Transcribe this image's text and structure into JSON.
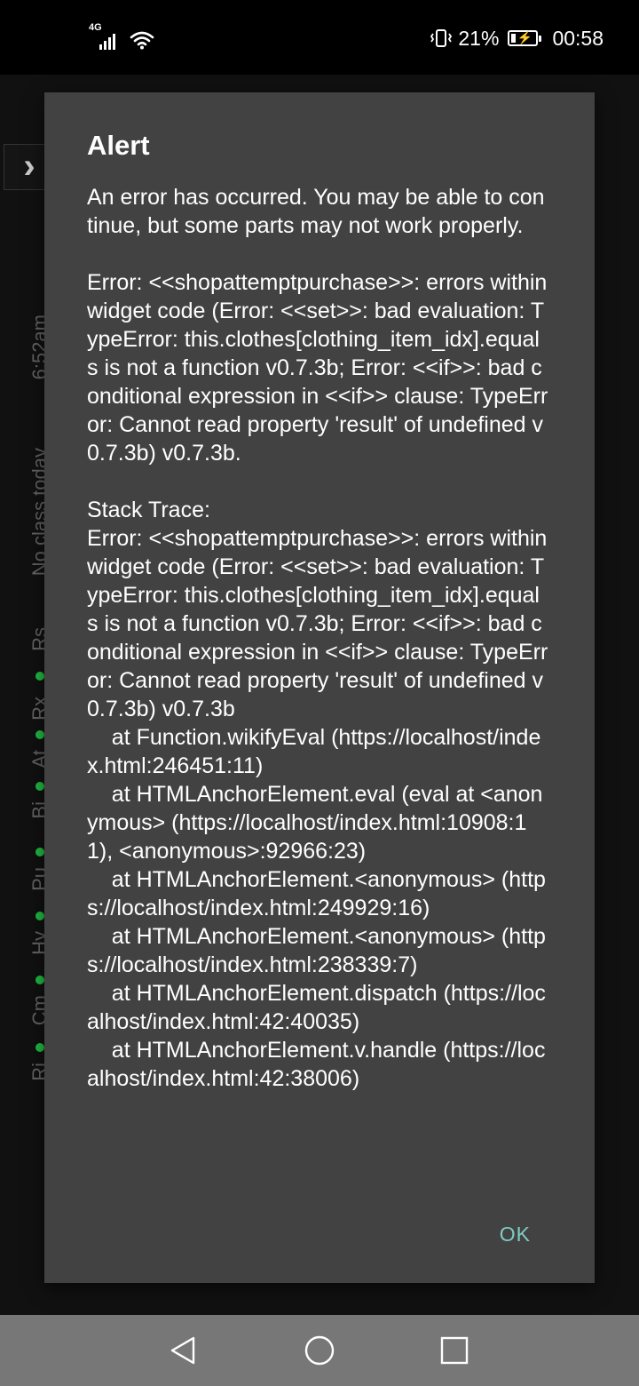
{
  "status_bar": {
    "network_type": "4G",
    "battery_percent": "21%",
    "battery_level": 0.21,
    "time": "00:58",
    "icons": [
      "signal-icon",
      "wifi-icon",
      "vibrate-icon",
      "battery-charging-icon"
    ]
  },
  "background": {
    "sidebar_labels": [
      "6:52am",
      "No class today",
      "Rs",
      "Rx",
      "At",
      "Bi",
      "Pu",
      "Hy",
      "Cm",
      "Ri"
    ],
    "accent_color": "#21c144",
    "button_color": "#b8890d"
  },
  "dialog": {
    "title": "Alert",
    "intro": "An error has occurred. You may be able to continue, but some parts may not work properly.",
    "error": "Error: <<shopattemptpurchase>>: errors within widget code (Error: <<set>>: bad evaluation: TypeError: this.clothes[clothing_item_idx].equals is not a function v0.7.3b; Error: <<if>>: bad conditional expression in <<if>> clause: TypeError: Cannot read property 'result' of undefined v0.7.3b) v0.7.3b.",
    "stack_label": "Stack Trace:",
    "stack_error": "Error: <<shopattemptpurchase>>: errors within widget code (Error: <<set>>: bad evaluation: TypeError: this.clothes[clothing_item_idx].equals is not a function v0.7.3b; Error: <<if>>: bad conditional expression in <<if>> clause: TypeError: Cannot read property 'result' of undefined v0.7.3b) v0.7.3b",
    "stack_frames": [
      "    at Function.wikifyEval (https://localhost/index.html:246451:11)",
      "    at HTMLAnchorElement.eval (eval at <anonymous> (https://localhost/index.html:10908:11), <anonymous>:92966:23)",
      "    at HTMLAnchorElement.<anonymous> (https://localhost/index.html:249929:16)",
      "    at HTMLAnchorElement.<anonymous> (https://localhost/index.html:238339:7)",
      "    at HTMLAnchorElement.dispatch (https://localhost/index.html:42:40035)",
      "    at HTMLAnchorElement.v.handle (https://localhost/index.html:42:38006)"
    ],
    "ok_label": "OK",
    "background_color": "#424242",
    "ok_color": "#80cbc4"
  },
  "nav_bar": {
    "buttons": [
      "back-icon",
      "home-icon",
      "recents-icon"
    ]
  }
}
